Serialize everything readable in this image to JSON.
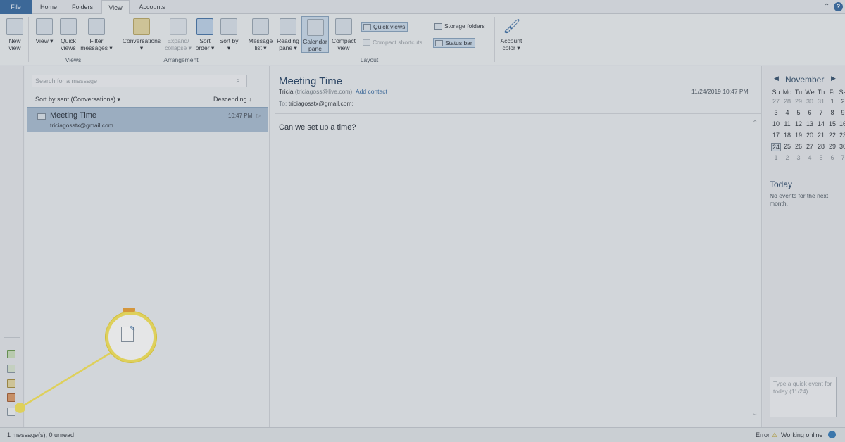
{
  "tabs": {
    "file": "File",
    "home": "Home",
    "folders": "Folders",
    "view": "View",
    "accounts": "Accounts"
  },
  "ribbon": {
    "new_view": "New view",
    "view": "View",
    "quick_views": "Quick views",
    "filter_messages": "Filter messages",
    "group_views": "Views",
    "conversations": "Conversations",
    "expand_collapse": "Expand/ collapse",
    "sort_order": "Sort order",
    "sort_by": "Sort by",
    "group_arrangement": "Arrangement",
    "message_list": "Message list",
    "reading_pane": "Reading pane",
    "calendar_pane": "Calendar pane",
    "compact_view": "Compact view",
    "quick_views_toggle": "Quick views",
    "compact_shortcuts": "Compact shortcuts",
    "status_bar": "Status bar",
    "storage_folders": "Storage folders",
    "group_layout": "Layout",
    "account_color": "Account color"
  },
  "list": {
    "search_placeholder": "Search for a message",
    "sort_label": "Sort by sent (Conversations)",
    "order_label": "Descending",
    "message": {
      "subject": "Meeting Time",
      "from": "triciagosstx@gmail.com",
      "time": "10:47 PM"
    }
  },
  "reading": {
    "subject": "Meeting Time",
    "sender_name": "Tricia",
    "sender_email": "(triciagoss@live.com)",
    "add_contact": "Add contact",
    "date": "11/24/2019 10:47 PM",
    "to_label": "To:",
    "to": "triciagosstx@gmail.com;",
    "body": "Can we set up a time?"
  },
  "calendar": {
    "month": "November",
    "weekdays": [
      "Su",
      "Mo",
      "Tu",
      "We",
      "Th",
      "Fr",
      "Sa"
    ],
    "weeks": [
      [
        "27",
        "28",
        "29",
        "30",
        "31",
        "1",
        "2"
      ],
      [
        "3",
        "4",
        "5",
        "6",
        "7",
        "8",
        "9"
      ],
      [
        "10",
        "11",
        "12",
        "13",
        "14",
        "15",
        "16"
      ],
      [
        "17",
        "18",
        "19",
        "20",
        "21",
        "22",
        "23"
      ],
      [
        "24",
        "25",
        "26",
        "27",
        "28",
        "29",
        "30"
      ],
      [
        "1",
        "2",
        "3",
        "4",
        "5",
        "6",
        "7"
      ]
    ],
    "today_heading": "Today",
    "no_events": "No events for the next month.",
    "quick_event_placeholder": "Type a quick event for today (11/24)"
  },
  "status": {
    "left": "1 message(s), 0 unread",
    "error": "Error",
    "online": "Working online"
  },
  "colors": {
    "file_tab": "#3f6fa3",
    "callout": "#f3e25f",
    "selected_row": "#a9bbd0"
  }
}
